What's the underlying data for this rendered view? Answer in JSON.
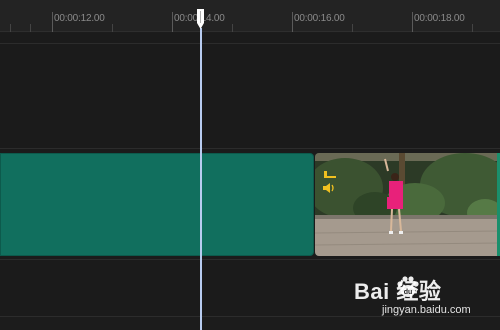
{
  "ruler": {
    "labels": [
      "00:00:12.00",
      "00:00:14.00",
      "00:00:16.00",
      "00:00:18.00"
    ]
  },
  "watermark": {
    "brand": "Bai  经验",
    "site": "jingyan.baidu.com"
  },
  "colors": {
    "background": "#1c1c1c",
    "ruler": "#232323",
    "audio_clip": "#116f5e",
    "playhead": "#b8ccf0"
  },
  "icons": [
    "playhead-handle-icon",
    "link-icon",
    "speaker-icon",
    "paw-logo-icon"
  ]
}
